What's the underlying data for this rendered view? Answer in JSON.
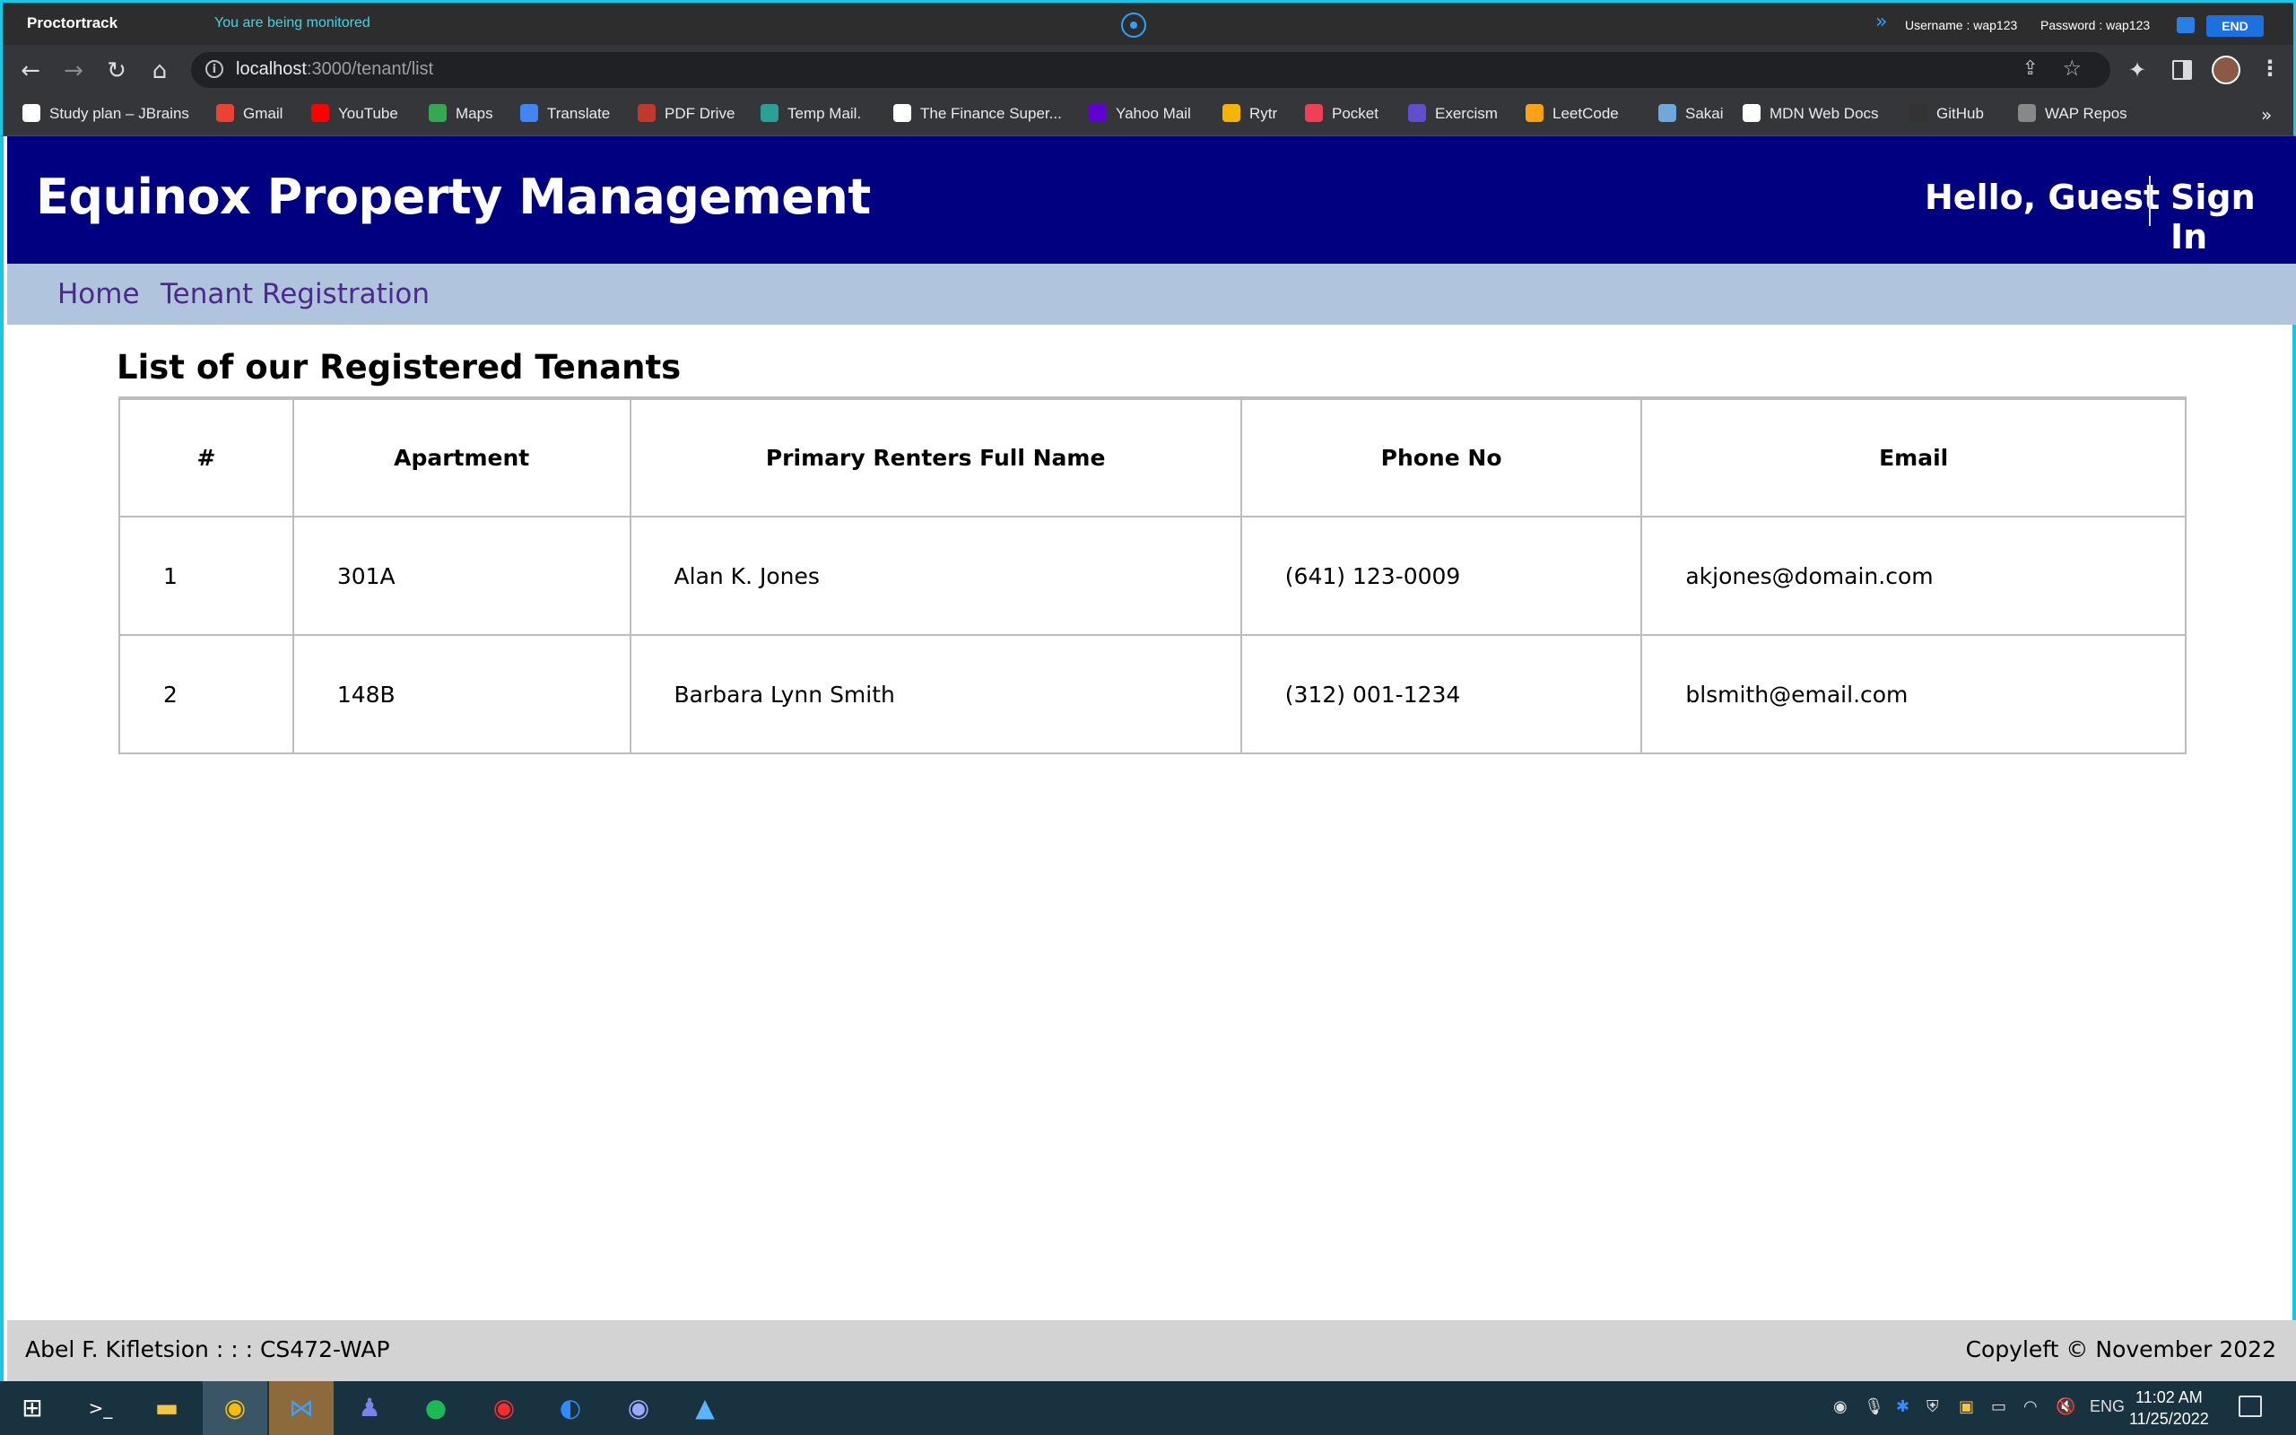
{
  "proctor": {
    "brand": "Proctortrack",
    "monitor_text": "You are being monitored",
    "username": "Username : wap123",
    "password": "Password : wap123",
    "end_label": "END"
  },
  "browser": {
    "url_host": "localhost",
    "url_path": ":3000/tenant/list",
    "bookmarks": [
      {
        "label": "Study plan – JBrains",
        "color": "#ffffff"
      },
      {
        "label": "Gmail",
        "color": "#ea4335"
      },
      {
        "label": "YouTube",
        "color": "#ff0000"
      },
      {
        "label": "Maps",
        "color": "#34a853"
      },
      {
        "label": "Translate",
        "color": "#4285f4"
      },
      {
        "label": "PDF Drive",
        "color": "#c0392b"
      },
      {
        "label": "Temp Mail.",
        "color": "#2aa198"
      },
      {
        "label": "The Finance Super...",
        "color": "#ffffff"
      },
      {
        "label": "Yahoo Mail",
        "color": "#6001d2"
      },
      {
        "label": "Rytr",
        "color": "#f5b400"
      },
      {
        "label": "Pocket",
        "color": "#ef4056"
      },
      {
        "label": "Exercism",
        "color": "#604fcd"
      },
      {
        "label": "LeetCode",
        "color": "#ffa116"
      },
      {
        "label": "Sakai",
        "color": "#6fa8dc"
      },
      {
        "label": "MDN Web Docs",
        "color": "#ffffff"
      },
      {
        "label": "GitHub",
        "color": "#333333"
      },
      {
        "label": "WAP Repos",
        "color": "#888888"
      }
    ]
  },
  "site": {
    "title": "Equinox Property Management",
    "greeting": "Hello, Guest",
    "signin": "Sign In",
    "nav": {
      "home": "Home",
      "registration": "Tenant Registration"
    },
    "list_title": "List of our Registered Tenants",
    "table": {
      "headers": [
        "#",
        "Apartment",
        "Primary Renters Full Name",
        "Phone No",
        "Email"
      ],
      "rows": [
        [
          "1",
          "301A",
          "Alan K. Jones",
          "(641) 123-0009",
          "akjones@domain.com"
        ],
        [
          "2",
          "148B",
          "Barbara Lynn Smith",
          "(312) 001-1234",
          "blsmith@email.com"
        ]
      ]
    },
    "footer_left": "Abel F. Kifletsion : : : CS472-WAP",
    "footer_right": "Copyleft © November 2022"
  },
  "taskbar": {
    "lang": "ENG",
    "time": "11:02 AM",
    "date": "11/25/2022"
  },
  "colors": {
    "header_bg": "#000080",
    "nav_bg": "#b0c4de",
    "nav_link": "#4b2a8c",
    "monitor_accent": "#19c6e6"
  }
}
